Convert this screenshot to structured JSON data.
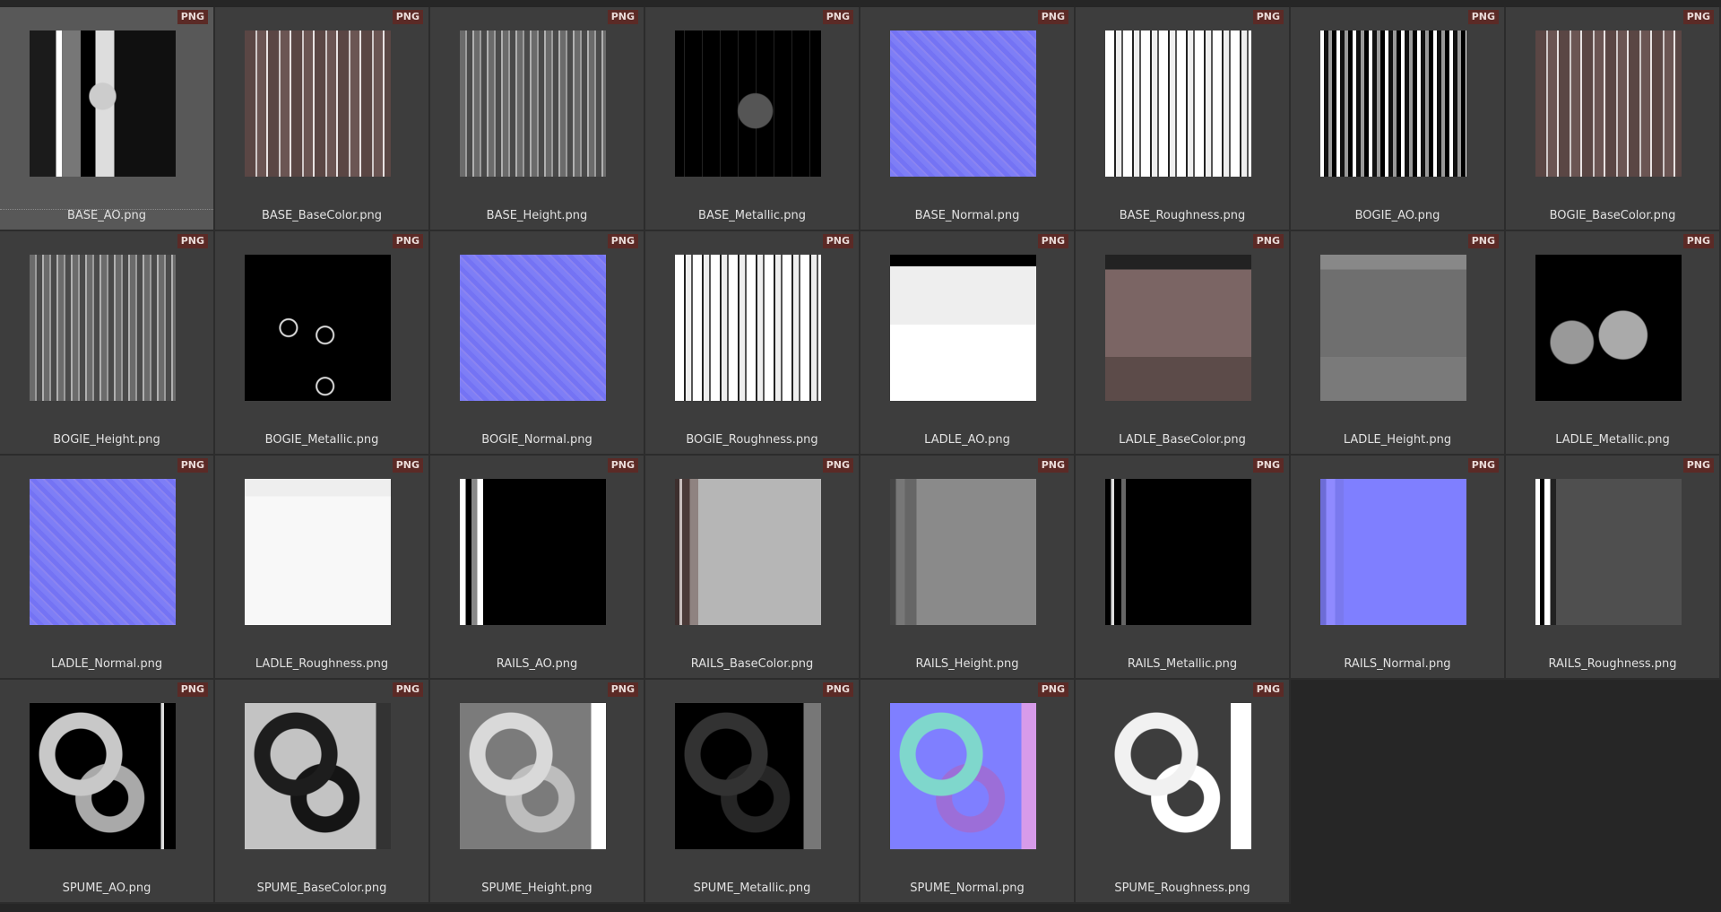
{
  "badge_label": "PNG",
  "files": [
    {
      "name": "BASE_AO.png",
      "group": "base",
      "map": "ao",
      "selected": true
    },
    {
      "name": "BASE_BaseColor.png",
      "group": "base",
      "map": "basecolor"
    },
    {
      "name": "BASE_Height.png",
      "group": "base",
      "map": "height"
    },
    {
      "name": "BASE_Metallic.png",
      "group": "base",
      "map": "metallic"
    },
    {
      "name": "BASE_Normal.png",
      "group": "base",
      "map": "normal"
    },
    {
      "name": "BASE_Roughness.png",
      "group": "base",
      "map": "roughness"
    },
    {
      "name": "BOGIE_AO.png",
      "group": "bogie",
      "map": "ao"
    },
    {
      "name": "BOGIE_BaseColor.png",
      "group": "bogie",
      "map": "basecolor"
    },
    {
      "name": "BOGIE_Height.png",
      "group": "bogie",
      "map": "height"
    },
    {
      "name": "BOGIE_Metallic.png",
      "group": "bogie",
      "map": "bogie-metallic"
    },
    {
      "name": "BOGIE_Normal.png",
      "group": "bogie",
      "map": "normal"
    },
    {
      "name": "BOGIE_Roughness.png",
      "group": "bogie",
      "map": "roughness"
    },
    {
      "name": "LADLE_AO.png",
      "group": "ladle",
      "map": "ao"
    },
    {
      "name": "LADLE_BaseColor.png",
      "group": "ladle",
      "map": "basecolor"
    },
    {
      "name": "LADLE_Height.png",
      "group": "ladle",
      "map": "height"
    },
    {
      "name": "LADLE_Metallic.png",
      "group": "ladle",
      "map": "metallic"
    },
    {
      "name": "LADLE_Normal.png",
      "group": "ladle",
      "map": "normal"
    },
    {
      "name": "LADLE_Roughness.png",
      "group": "ladle",
      "map": "roughness"
    },
    {
      "name": "RAILS_AO.png",
      "group": "rails",
      "map": "ao"
    },
    {
      "name": "RAILS_BaseColor.png",
      "group": "rails",
      "map": "basecolor"
    },
    {
      "name": "RAILS_Height.png",
      "group": "rails",
      "map": "height"
    },
    {
      "name": "RAILS_Metallic.png",
      "group": "rails",
      "map": "metallic"
    },
    {
      "name": "RAILS_Normal.png",
      "group": "rails",
      "map": "normal"
    },
    {
      "name": "RAILS_Roughness.png",
      "group": "rails",
      "map": "roughness"
    },
    {
      "name": "SPUME_AO.png",
      "group": "spume",
      "map": "ao"
    },
    {
      "name": "SPUME_BaseColor.png",
      "group": "spume",
      "map": "basecolor"
    },
    {
      "name": "SPUME_Height.png",
      "group": "spume",
      "map": "height"
    },
    {
      "name": "SPUME_Metallic.png",
      "group": "spume",
      "map": "metallic"
    },
    {
      "name": "SPUME_Normal.png",
      "group": "spume",
      "map": "normal"
    },
    {
      "name": "SPUME_Roughness.png",
      "group": "spume",
      "map": "roughness"
    }
  ],
  "colors": {
    "background": "#262626",
    "tile": "#3d3d3d",
    "tile_selected": "#585858",
    "badge_bg": "#5b2a26",
    "badge_text": "#eadbd8",
    "caption_text": "#e2e2e2"
  }
}
